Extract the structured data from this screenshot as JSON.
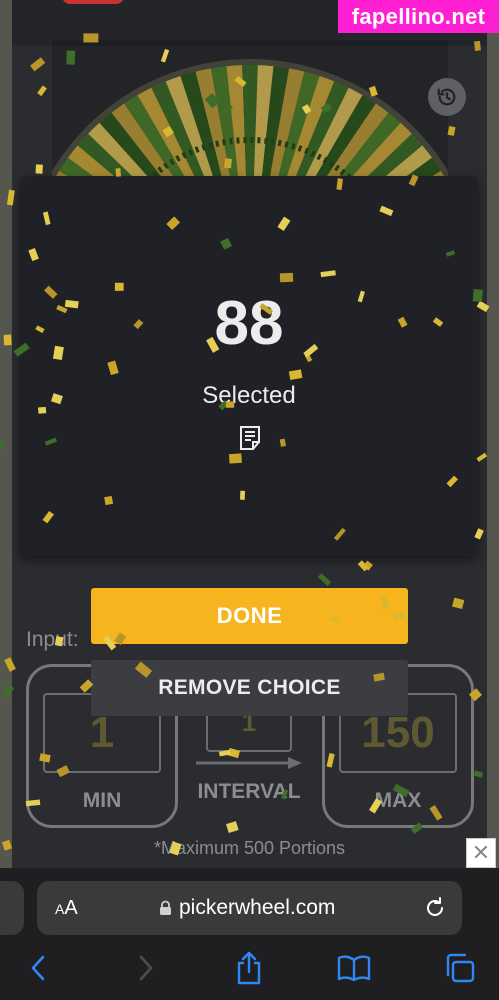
{
  "watermark": "fapellino.net",
  "result": {
    "value": "88",
    "label": "Selected"
  },
  "buttons": {
    "done": "DONE",
    "remove_choice": "REMOVE CHOICE"
  },
  "input_panel": {
    "label": "Input:",
    "min_value": "1",
    "min_caption": "MIN",
    "interval_value": "1",
    "interval_caption": "INTERVAL",
    "max_value": "150",
    "max_caption": "MAX",
    "note": "*Maximum 500 Portions"
  },
  "browser": {
    "text_size_label": "AA",
    "url": "pickerwheel.com"
  },
  "icons": {
    "history": "history-icon",
    "document": "document-icon",
    "lock": "lock-icon",
    "reload": "reload-icon",
    "back": "chevron-left-icon",
    "forward": "chevron-right-icon",
    "share": "share-icon",
    "bookmarks": "book-icon",
    "tabs": "tabs-icon",
    "ad_close": "close-icon"
  },
  "colors": {
    "accent": "#f6b51e",
    "modal_bg": "#1f2127",
    "watermark_bg": "#ff1fd3"
  }
}
